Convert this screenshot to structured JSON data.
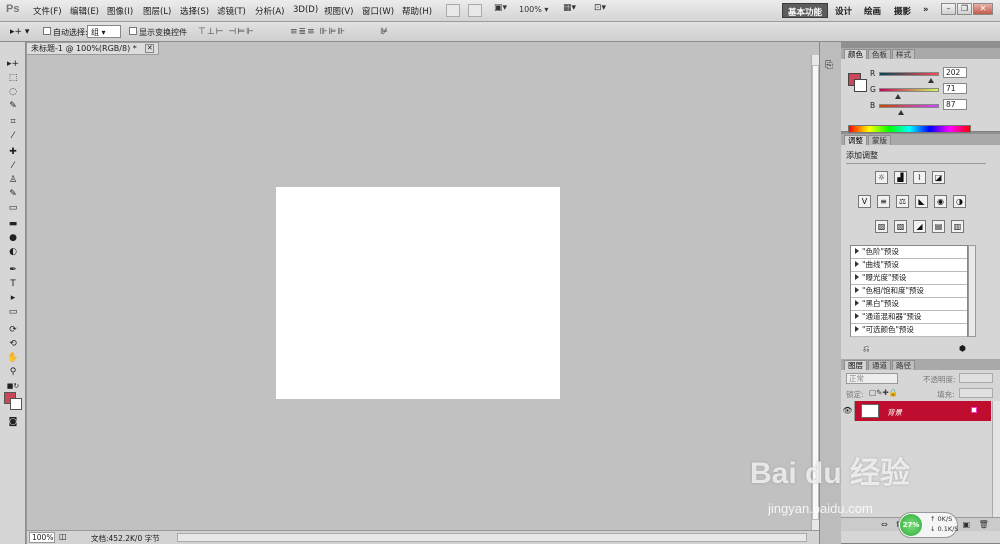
{
  "app": {
    "logo": "Ps"
  },
  "menu": [
    "文件(F)",
    "编辑(E)",
    "图像(I)",
    "图层(L)",
    "选择(S)",
    "滤镜(T)",
    "分析(A)",
    "3D(D)",
    "视图(V)",
    "窗口(W)",
    "帮助(H)"
  ],
  "menubar": {
    "zoom": "100%",
    "workspaces": [
      "基本功能",
      "设计",
      "绘画",
      "摄影"
    ],
    "more": "»"
  },
  "options": {
    "auto_select_label": "自动选择:",
    "auto_select_value": "组",
    "show_transform_label": "显示变换控件"
  },
  "document": {
    "tab_title": "未标题-1 @ 100%(RGB/8) *",
    "status_zoom": "100%",
    "status_info": "文档:452.2K/0 字节"
  },
  "color_panel": {
    "tabs": [
      "颜色",
      "色板",
      "样式"
    ],
    "channels": [
      {
        "label": "R",
        "value": "202"
      },
      {
        "label": "G",
        "value": "71"
      },
      {
        "label": "B",
        "value": "87"
      }
    ],
    "foreground": "#ca4757",
    "background": "#ffffff"
  },
  "adjust_panel": {
    "tabs": [
      "调整",
      "蒙版"
    ],
    "title": "添加调整",
    "presets": [
      "\"色阶\"预设",
      "\"曲线\"预设",
      "\"曝光度\"预设",
      "\"色相/饱和度\"预设",
      "\"黑白\"预设",
      "\"通道混和器\"预设",
      "\"可选颜色\"预设"
    ]
  },
  "layers_panel": {
    "tabs": [
      "图层",
      "通道",
      "路径"
    ],
    "blend_mode": "正常",
    "opacity_label": "不透明度:",
    "lock_label": "锁定:",
    "fill_label": "填充:",
    "layer_name": "背景",
    "selected_color": "#be0d2e"
  },
  "net_widget": {
    "percent": "27%",
    "up": "0K/S",
    "down": "0.1K/S"
  },
  "watermark": {
    "text": "Bai du 经验",
    "sub": "jingyan.baidu.com"
  }
}
